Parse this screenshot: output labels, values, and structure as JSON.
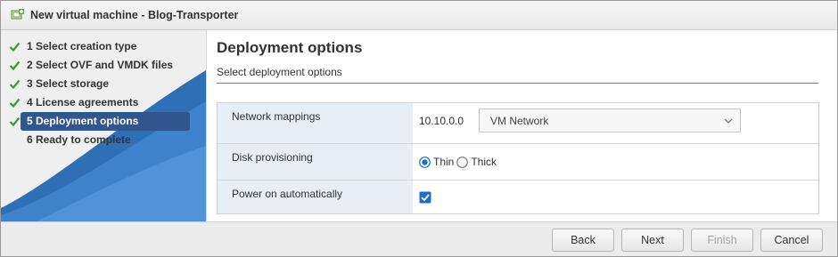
{
  "window": {
    "title": "New virtual machine - Blog-Transporter"
  },
  "wizard": {
    "steps": [
      {
        "label": "1  Select creation type",
        "done": true
      },
      {
        "label": "2  Select OVF and VMDK files",
        "done": true
      },
      {
        "label": "3  Select storage",
        "done": true
      },
      {
        "label": "4  License agreements",
        "done": true
      },
      {
        "label": "5  Deployment options",
        "done": true,
        "active": true
      },
      {
        "label": "6  Ready to complete",
        "done": false
      }
    ]
  },
  "page": {
    "title": "Deployment options",
    "subtitle": "Select deployment options"
  },
  "options": {
    "network_mappings": {
      "label": "Network mappings",
      "source": "10.10.0.0",
      "selected": "VM Network"
    },
    "disk_provisioning": {
      "label": "Disk provisioning",
      "choices": [
        "Thin",
        "Thick"
      ],
      "selected": "Thin"
    },
    "power_on": {
      "label": "Power on automatically",
      "checked": true
    }
  },
  "footer": {
    "back": "Back",
    "next": "Next",
    "finish": "Finish",
    "cancel": "Cancel"
  },
  "colors": {
    "accent": "#30568d",
    "sidebar_wave": "#3d7cc2",
    "check": "#3a9a3a",
    "label_bg": "#e8eef6",
    "radio_on": "#1f6fc4"
  }
}
